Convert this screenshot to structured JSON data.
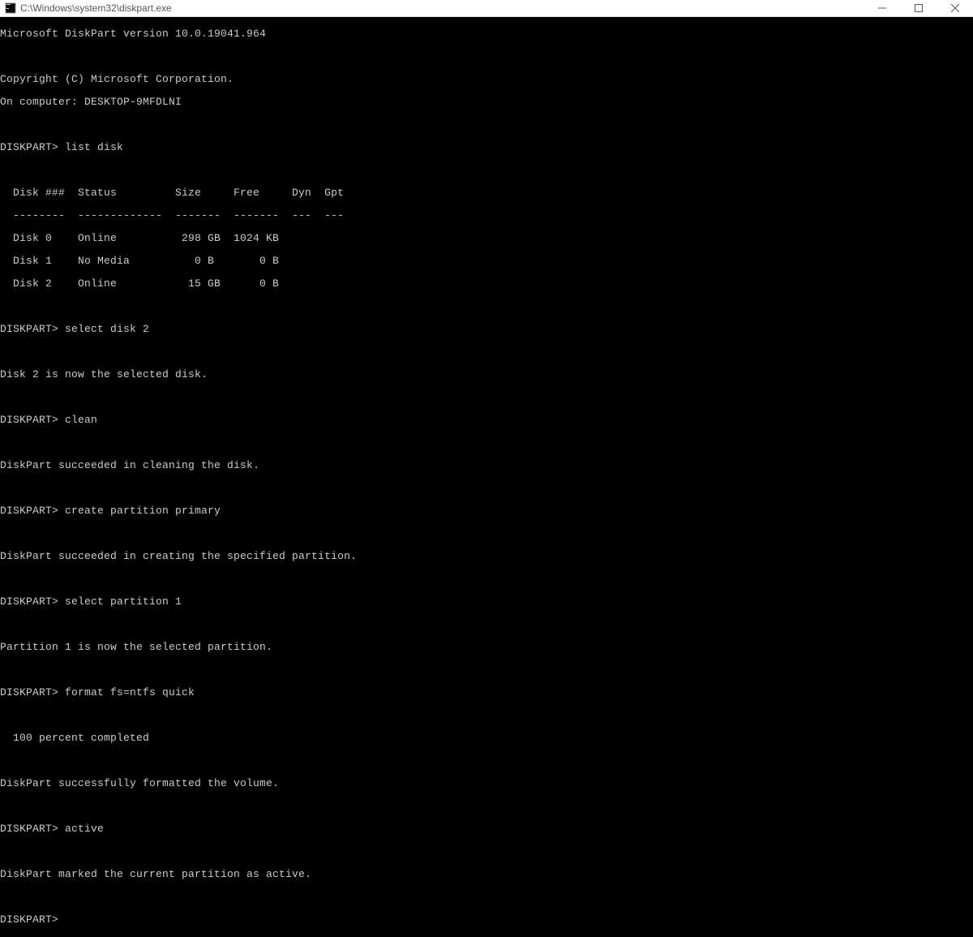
{
  "window": {
    "title": "C:\\Windows\\system32\\diskpart.exe"
  },
  "header": {
    "version_line": "Microsoft DiskPart version 10.0.19041.964",
    "copyright": "Copyright (C) Microsoft Corporation.",
    "computer": "On computer: DESKTOP-9MFDLNI"
  },
  "prompt": "DISKPART>",
  "commands": {
    "list_disk": "list disk",
    "select_disk": "select disk 2",
    "clean": "clean",
    "create_partition": "create partition primary",
    "select_partition": "select partition 1",
    "format": "format fs=ntfs quick",
    "active": "active"
  },
  "table": {
    "header": "  Disk ###  Status         Size     Free     Dyn  Gpt",
    "divider": "  --------  -------------  -------  -------  ---  ---",
    "rows": [
      "  Disk 0    Online          298 GB  1024 KB",
      "  Disk 1    No Media          0 B       0 B",
      "  Disk 2    Online           15 GB      0 B"
    ]
  },
  "responses": {
    "disk_selected": "Disk 2 is now the selected disk.",
    "clean_ok": "DiskPart succeeded in cleaning the disk.",
    "partition_created": "DiskPart succeeded in creating the specified partition.",
    "partition_selected": "Partition 1 is now the selected partition.",
    "format_progress": "  100 percent completed",
    "format_ok": "DiskPart successfully formatted the volume.",
    "active_ok": "DiskPart marked the current partition as active."
  }
}
